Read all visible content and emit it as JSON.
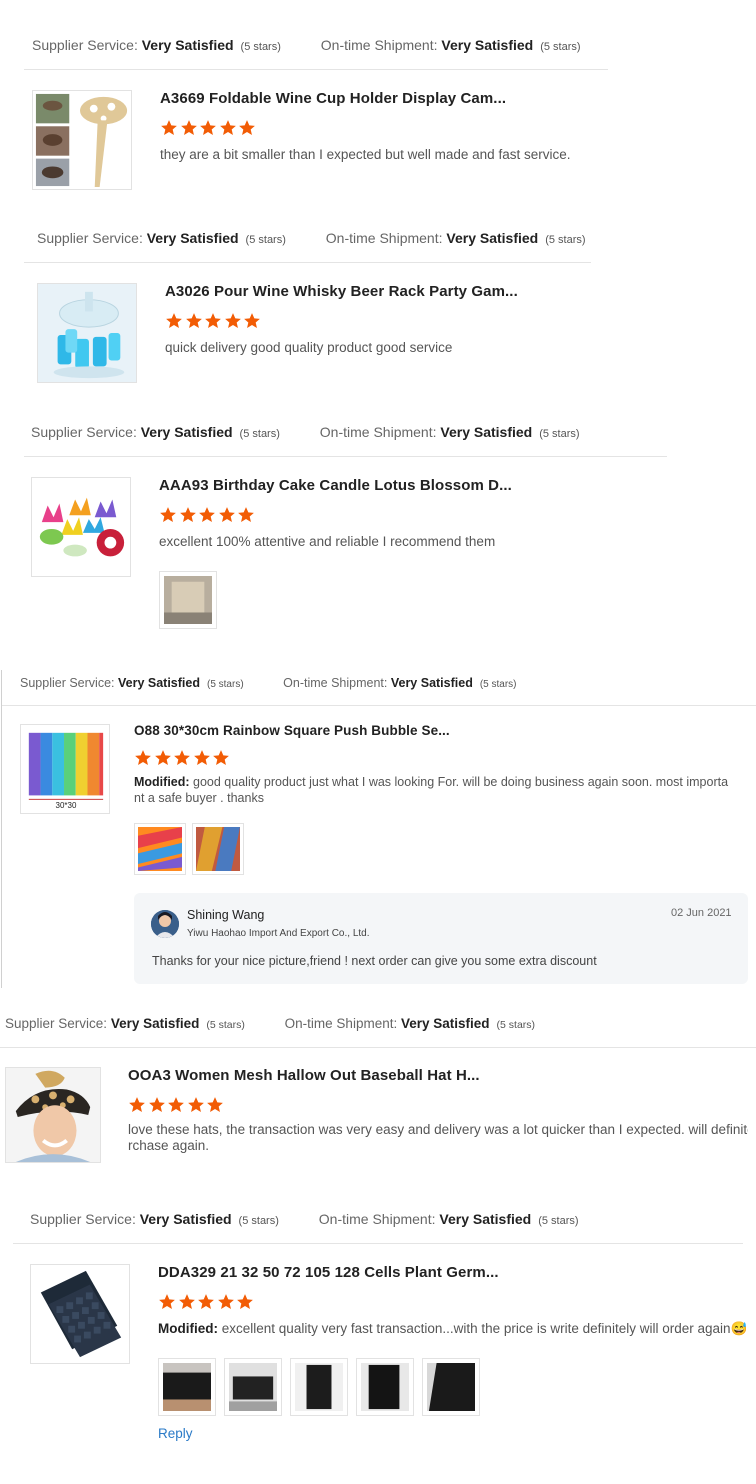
{
  "labels": {
    "supplier_service": "Supplier Service:",
    "on_time_shipment": "On-time Shipment:",
    "modified": "Modified:",
    "reply": "Reply"
  },
  "colors": {
    "star": "#f25c05",
    "link": "#2a7ac7"
  },
  "reviews": [
    {
      "supplier_service": "Very Satisfied",
      "supplier_stars": "(5 stars)",
      "shipment": "Very Satisfied",
      "shipment_stars": "(5 stars)",
      "title": "A3669 Foldable Wine Cup Holder Display Cam...",
      "rating": 5,
      "comment": "they are a bit smaller than I expected but well made and fast service.",
      "thumbnail_icon": "wine-holder-image"
    },
    {
      "supplier_service": "Very Satisfied",
      "supplier_stars": "(5 stars)",
      "shipment": "Very Satisfied",
      "shipment_stars": "(5 stars)",
      "title": "A3026 Pour Wine Whisky Beer Rack Party Gam...",
      "rating": 5,
      "comment": "quick delivery good quality product good service",
      "thumbnail_icon": "wine-rack-image"
    },
    {
      "supplier_service": "Very Satisfied",
      "supplier_stars": "(5 stars)",
      "shipment": "Very Satisfied",
      "shipment_stars": "(5 stars)",
      "title": "AAA93 Birthday Cake Candle Lotus Blossom D...",
      "rating": 5,
      "comment": "excellent 100% attentive and reliable I recommend them",
      "thumbnail_icon": "lotus-candle-image"
    },
    {
      "supplier_service": "Very Satisfied",
      "supplier_stars": "(5 stars)",
      "shipment": "Very Satisfied",
      "shipment_stars": "(5 stars)",
      "title": "O88 30*30cm Rainbow Square Push Bubble Se...",
      "rating": 5,
      "comment_line1": "good quality product just what I was looking For. will be doing business again soon. most importa",
      "comment_line2": "nt a safe buyer . thanks",
      "thumbnail_caption": "30*30",
      "thumbnail_icon": "rainbow-bubble-image",
      "seller_reply": {
        "name": "Shining Wang",
        "company": "Yiwu Haohao Import And Export Co., Ltd.",
        "date": "02 Jun 2021",
        "text": "Thanks for your nice picture,friend ! next order can give you some extra discount"
      }
    },
    {
      "supplier_service": "Very Satisfied",
      "supplier_stars": "(5 stars)",
      "shipment": "Very Satisfied",
      "shipment_stars": "(5 stars)",
      "title": "OOA3 Women Mesh Hallow Out Baseball Hat H...",
      "rating": 5,
      "comment_line1": "love these hats, the transaction was very easy and delivery was a lot quicker than I expected. will definitely pu",
      "comment_line2": "rchase again.",
      "thumbnail_icon": "baseball-hat-image"
    },
    {
      "supplier_service": "Very Satisfied",
      "supplier_stars": "(5 stars)",
      "shipment": "Very Satisfied",
      "shipment_stars": "(5 stars)",
      "title": "DDA329 21 32 50 72 105 128 Cells Plant Germ...",
      "rating": 5,
      "comment": "excellent quality very fast transaction...with the price is write definitely will order again😅",
      "thumbnail_icon": "seed-tray-image"
    }
  ]
}
